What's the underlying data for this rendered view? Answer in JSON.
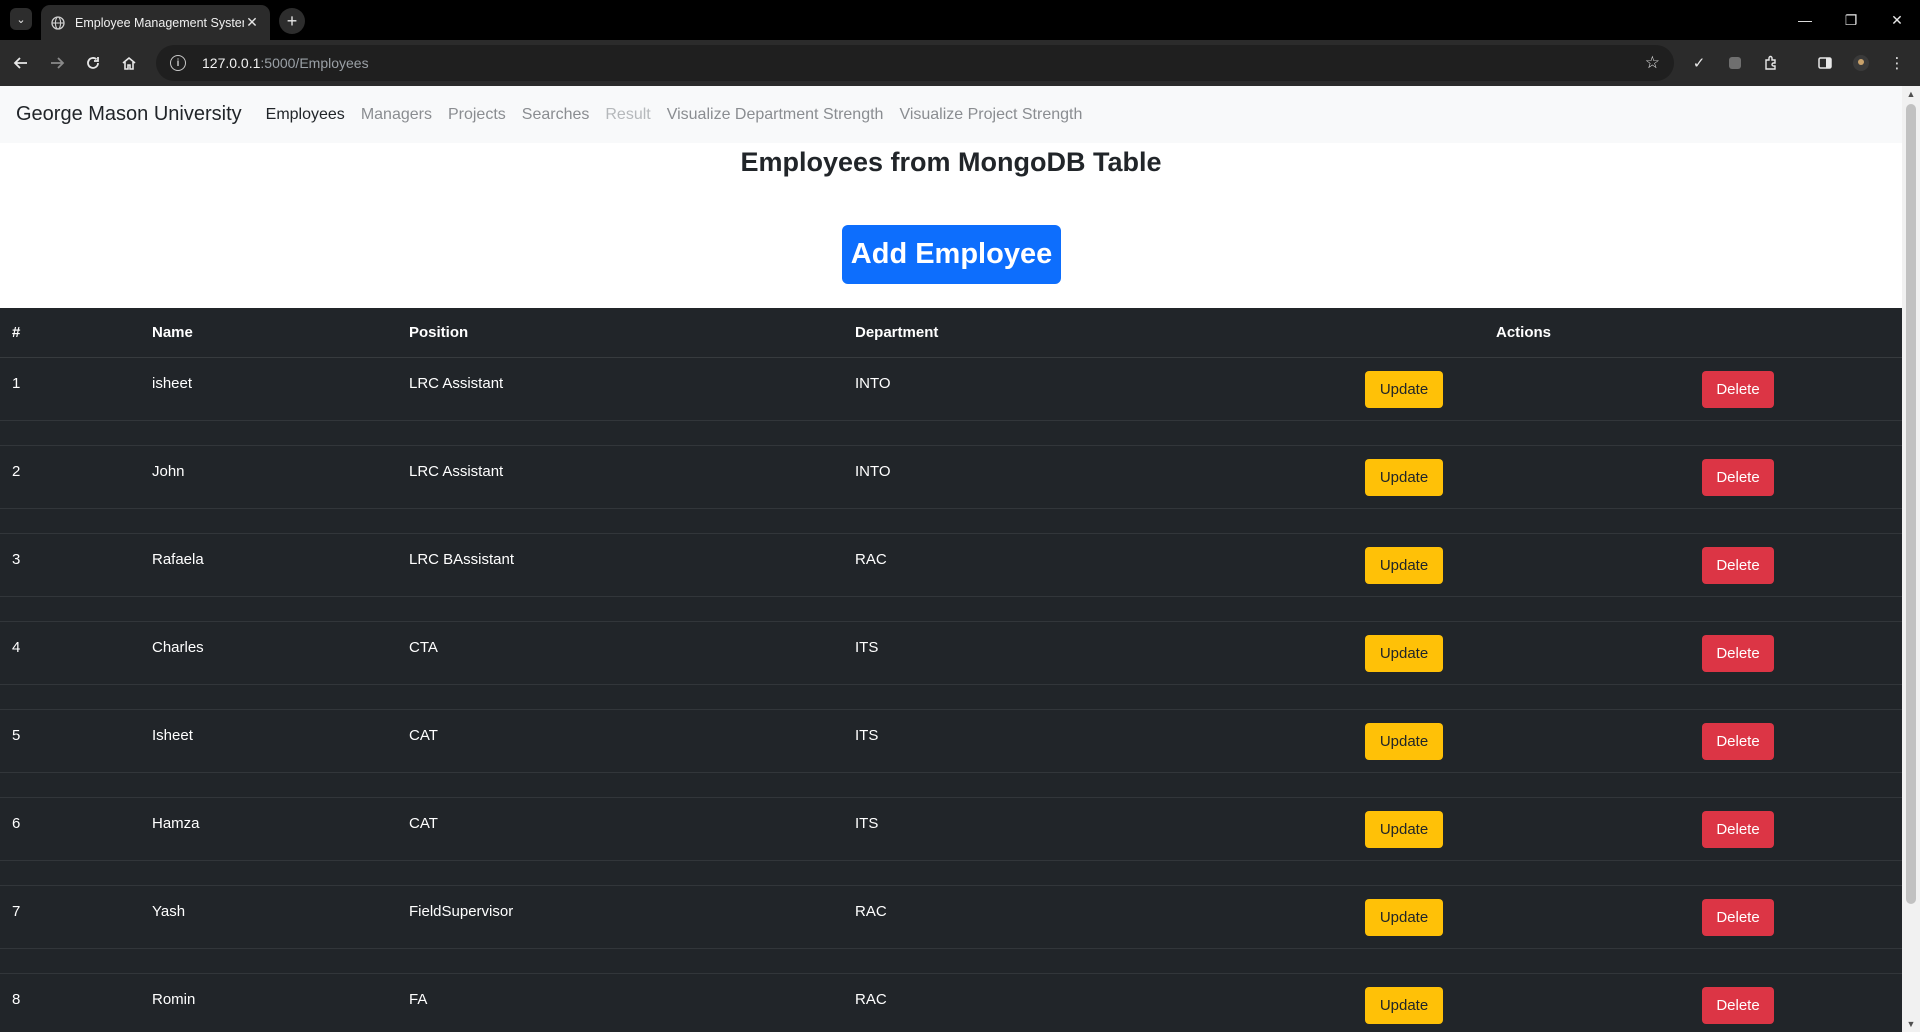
{
  "browser": {
    "tab_title": "Employee Management System",
    "url_host": "127.0.0.1",
    "url_path": ":5000/Employees"
  },
  "navbar": {
    "brand": "George Mason University",
    "links": [
      "Employees",
      "Managers",
      "Projects",
      "Searches",
      "Result",
      "Visualize Department Strength",
      "Visualize Project Strength"
    ],
    "active": "Employees",
    "disabled": "Result"
  },
  "main": {
    "heading": "Employees from MongoDB Table",
    "add_button": "Add Employee"
  },
  "table": {
    "headers": [
      "#",
      "Name",
      "Position",
      "Department",
      "Actions"
    ],
    "update_label": "Update",
    "delete_label": "Delete",
    "rows": [
      {
        "num": "1",
        "name": "isheet",
        "position": "LRC Assistant",
        "department": "INTO"
      },
      {
        "num": "2",
        "name": "John",
        "position": "LRC Assistant",
        "department": "INTO"
      },
      {
        "num": "3",
        "name": "Rafaela",
        "position": "LRC BAssistant",
        "department": "RAC"
      },
      {
        "num": "4",
        "name": "Charles",
        "position": "CTA",
        "department": "ITS"
      },
      {
        "num": "5",
        "name": "Isheet",
        "position": "CAT",
        "department": "ITS"
      },
      {
        "num": "6",
        "name": "Hamza",
        "position": "CAT",
        "department": "ITS"
      },
      {
        "num": "7",
        "name": "Yash",
        "position": "FieldSupervisor",
        "department": "RAC"
      },
      {
        "num": "8",
        "name": "Romin",
        "position": "FA",
        "department": "RAC"
      }
    ]
  },
  "colors": {
    "primary": "#0d6efd",
    "warning": "#ffc107",
    "danger": "#dc3545",
    "table_dark": "#212529"
  }
}
